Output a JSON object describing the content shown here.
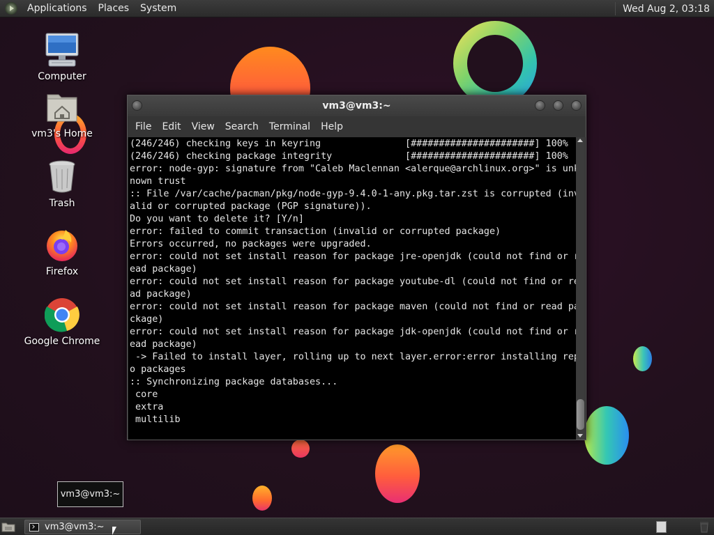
{
  "top_panel": {
    "menus": [
      "Applications",
      "Places",
      "System"
    ],
    "clock": "Wed Aug  2, 03:18"
  },
  "desktop_icons": [
    {
      "label": "Computer",
      "icon": "computer-icon"
    },
    {
      "label": "vm3's Home",
      "icon": "home-folder-icon"
    },
    {
      "label": "Trash",
      "icon": "trash-icon"
    },
    {
      "label": "Firefox",
      "icon": "firefox-icon"
    },
    {
      "label": "Google Chrome",
      "icon": "chrome-icon"
    }
  ],
  "terminal": {
    "title": "vm3@vm3:~",
    "menu": [
      "File",
      "Edit",
      "View",
      "Search",
      "Terminal",
      "Help"
    ],
    "lines": [
      "(246/246) checking keys in keyring               [######################] 100%",
      "(246/246) checking package integrity             [######################] 100%",
      "error: node-gyp: signature from \"Caleb Maclennan <alerque@archlinux.org>\" is unk",
      "nown trust",
      ":: File /var/cache/pacman/pkg/node-gyp-9.4.0-1-any.pkg.tar.zst is corrupted (inv",
      "alid or corrupted package (PGP signature)).",
      "Do you want to delete it? [Y/n]",
      "error: failed to commit transaction (invalid or corrupted package)",
      "Errors occurred, no packages were upgraded.",
      "error: could not set install reason for package jre-openjdk (could not find or r",
      "ead package)",
      "error: could not set install reason for package youtube-dl (could not find or re",
      "ad package)",
      "error: could not set install reason for package maven (could not find or read pa",
      "ckage)",
      "error: could not set install reason for package jdk-openjdk (could not find or r",
      "ead package)",
      " -> Failed to install layer, rolling up to next layer.error:error installing rep",
      "o packages",
      ":: Synchronizing package databases...",
      " core",
      " extra",
      " multilib"
    ]
  },
  "tooltip": "vm3@vm3:~",
  "taskbar": {
    "task_label": "vm3@vm3:~"
  }
}
